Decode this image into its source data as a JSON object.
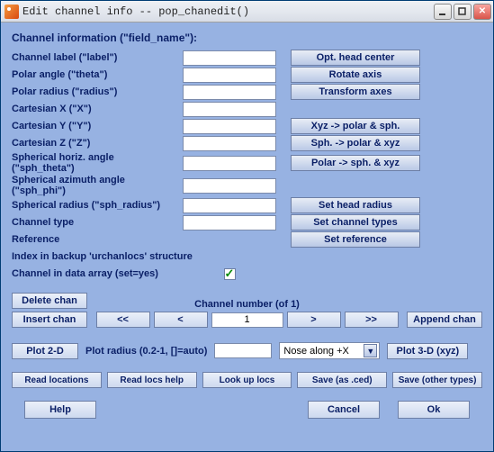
{
  "titlebar": {
    "title": "Edit channel info -- pop_chanedit()"
  },
  "section_heading": "Channel information (\"field_name\"):",
  "fields": {
    "label": {
      "label": "Channel label (\"label\")",
      "value": ""
    },
    "theta": {
      "label": "Polar angle (\"theta\")",
      "value": ""
    },
    "radius": {
      "label": "Polar radius (\"radius\")",
      "value": ""
    },
    "X": {
      "label": "Cartesian X (\"X\")",
      "value": ""
    },
    "Y": {
      "label": "Cartesian Y (\"Y\")",
      "value": ""
    },
    "Z": {
      "label": "Cartesian Z (\"Z\")",
      "value": ""
    },
    "sph_theta": {
      "label": "Spherical horiz. angle (\"sph_theta\")",
      "value": ""
    },
    "sph_phi": {
      "label": "Spherical azimuth angle (\"sph_phi\")",
      "value": ""
    },
    "sph_radius": {
      "label": "Spherical radius (\"sph_radius\")",
      "value": ""
    },
    "type": {
      "label": "Channel type",
      "value": ""
    },
    "reference": {
      "label": "Reference"
    },
    "urchan": {
      "label": "Index in backup 'urchanlocs' structure"
    },
    "in_data": {
      "label": "Channel in data array (set=yes)",
      "checked": true
    }
  },
  "right_buttons": {
    "opt_head_center": "Opt. head center",
    "rotate_axis": "Rotate axis",
    "transform_axes": "Transform axes",
    "xyz_to_polar_sph": "Xyz -> polar & sph.",
    "sph_to_polar_xyz": "Sph. -> polar & xyz",
    "polar_to_sph_xyz": "Polar -> sph. & xyz",
    "set_head_radius": "Set head radius",
    "set_channel_types": "Set channel types",
    "set_reference": "Set reference"
  },
  "chan_nav": {
    "delete": "Delete chan",
    "insert": "Insert chan",
    "first": "<<",
    "prev": "<",
    "number": "1",
    "count_label": "Channel number (of 1)",
    "next": ">",
    "last": ">>",
    "append": "Append chan"
  },
  "plot": {
    "plot2d": "Plot 2-D",
    "radius_label": "Plot radius (0.2-1, []=auto)",
    "radius_value": "",
    "nose_select": "Nose along +X",
    "plot3d": "Plot 3-D (xyz)"
  },
  "io": {
    "read_locations": "Read locations",
    "read_locs_help": "Read locs help",
    "look_up_locs": "Look up locs",
    "save_ced": "Save (as .ced)",
    "save_other": "Save (other types)"
  },
  "bottom": {
    "help": "Help",
    "cancel": "Cancel",
    "ok": "Ok"
  }
}
